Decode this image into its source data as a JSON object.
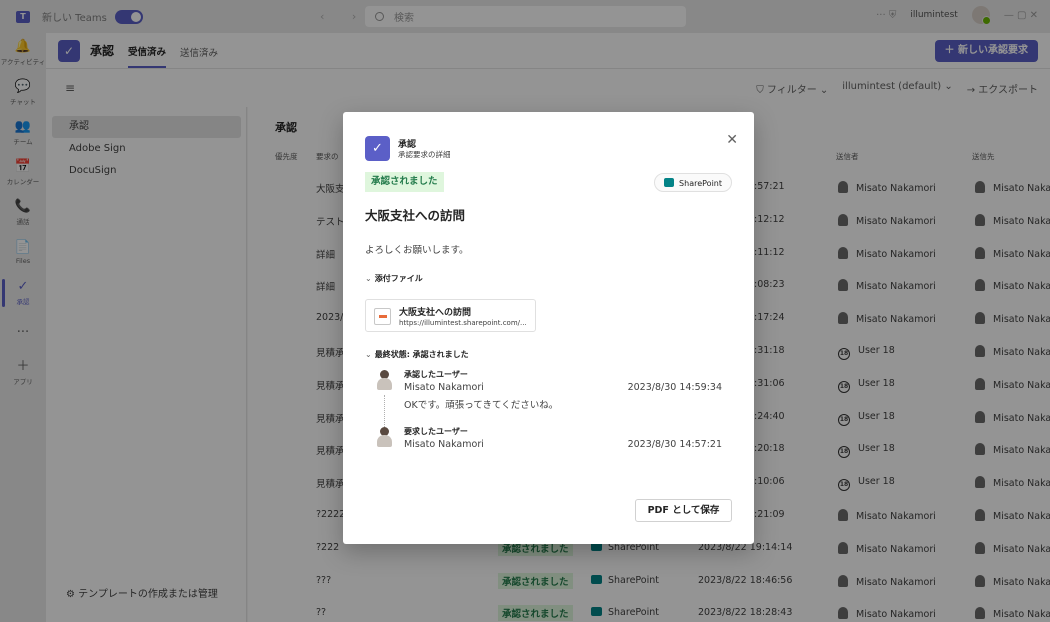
{
  "titlebar": {
    "new_teams_label": "新しい Teams",
    "search_placeholder": "検索",
    "user_name": "illumintest",
    "nav_arrows": "‹ ›",
    "right_icons": "··· ⛨",
    "window_controls": "— ▢ ✕"
  },
  "rail": {
    "items": [
      {
        "icon": "🔔",
        "label": "アクティビティ"
      },
      {
        "icon": "💬",
        "label": "チャット"
      },
      {
        "icon": "👥",
        "label": "チーム"
      },
      {
        "icon": "📅",
        "label": "カレンダー"
      },
      {
        "icon": "📞",
        "label": "通話"
      },
      {
        "icon": "📄",
        "label": "Files"
      },
      {
        "icon": "✓",
        "label": "承認"
      },
      {
        "icon": "···",
        "label": ""
      },
      {
        "icon": "＋",
        "label": "アプリ"
      }
    ]
  },
  "header": {
    "app_icon": "✓",
    "title": "承認",
    "tab_received": "受信済み",
    "tab_sent": "送信済み",
    "new_request_button": "＋ 新しい承認要求"
  },
  "toolbar": {
    "menu_icon": "≡",
    "filter_label": "⛉ フィルター ⌄",
    "environment_label": "illumintest (default) ⌄",
    "export_label": "→ エクスポート"
  },
  "sidelist": {
    "items": [
      "承認",
      "Adobe Sign",
      "DocuSign"
    ],
    "footer": "⚙ テンプレートの作成または管理"
  },
  "table": {
    "title": "承認",
    "headers": [
      "優先度",
      "要求の",
      "送信者",
      "送信先"
    ],
    "rows": [
      {
        "name": "大阪支",
        "time": ":57:21",
        "sender": "Misato Nakamori",
        "recipient": "Misato Nakan",
        "status": "",
        "source": "",
        "date": ""
      },
      {
        "name": "テスト",
        "time": ":12:12",
        "sender": "Misato Nakamori",
        "recipient": "Misato Nakan",
        "status": "",
        "source": "",
        "date": ""
      },
      {
        "name": "詳細",
        "time": ":11:12",
        "sender": "Misato Nakamori",
        "recipient": "Misato Nakan",
        "status": "",
        "source": "",
        "date": ""
      },
      {
        "name": "詳細",
        "time": ":08:23",
        "sender": "Misato Nakamori",
        "recipient": "Misato Nakan",
        "status": "",
        "source": "",
        "date": ""
      },
      {
        "name": "2023/",
        "time": ":17:24",
        "sender": "Misato Nakamori",
        "recipient": "Misato Nakan",
        "status": "",
        "source": "",
        "date": ""
      },
      {
        "name": "見積承",
        "time": ":31:18",
        "sender": "User 18",
        "recipient": "Misato Nakan",
        "status": "",
        "source": "",
        "date": ""
      },
      {
        "name": "見積承",
        "time": ":31:06",
        "sender": "User 18",
        "recipient": "Misato Nakan",
        "status": "",
        "source": "",
        "date": ""
      },
      {
        "name": "見積承",
        "time": ":24:40",
        "sender": "User 18",
        "recipient": "Misato Nakan",
        "status": "",
        "source": "",
        "date": ""
      },
      {
        "name": "見積承",
        "time": ":20:18",
        "sender": "User 18",
        "recipient": "Misato Nakan",
        "status": "",
        "source": "",
        "date": ""
      },
      {
        "name": "見積承",
        "time": ":10:06",
        "sender": "User 18",
        "recipient": "Misato Nakan",
        "status": "",
        "source": "",
        "date": ""
      },
      {
        "name": "?2222",
        "time": ":21:09",
        "sender": "Misato Nakamori",
        "recipient": "Misato Nakan",
        "status": "",
        "source": "",
        "date": ""
      },
      {
        "name": "?222",
        "time": "",
        "sender": "Misato Nakamori",
        "recipient": "Misato Nakan",
        "status": "承認されました",
        "source": "SharePoint",
        "date": "2023/8/22 19:14:14"
      },
      {
        "name": "???",
        "time": "",
        "sender": "Misato Nakamori",
        "recipient": "Misato Nakan",
        "status": "承認されました",
        "source": "SharePoint",
        "date": "2023/8/22 18:46:56"
      },
      {
        "name": "??",
        "time": "",
        "sender": "Misato Nakamori",
        "recipient": "Misato Nakan",
        "status": "承認されました",
        "source": "SharePoint",
        "date": "2023/8/22 18:28:43"
      }
    ]
  },
  "dialog": {
    "icon": "✓",
    "title": "承認",
    "subtitle": "承認要求の詳細",
    "close_icon": "✕",
    "status": "承認されました",
    "source": "SharePoint",
    "heading": "大阪支社への訪問",
    "message": "よろしくお願いします。",
    "attachments_header": "添付ファイル",
    "attachment_name": "大阪支社への訪問",
    "attachment_url": "https://illumintest.sharepoint.com/...",
    "final_status_header": "最終状態: 承認されました",
    "approver": {
      "role": "承認したユーザー",
      "name": "Misato Nakamori",
      "date": "2023/8/30 14:59:34",
      "note": "OKです。頑張ってきてくださいね。"
    },
    "requester": {
      "role": "要求したユーザー",
      "name": "Misato Nakamori",
      "date": "2023/8/30 14:57:21"
    },
    "pdf_button": "PDF として保存"
  },
  "colors": {
    "brand": "#5b5fc7",
    "status_green_bg": "#dff6dd",
    "status_green_text": "#237b4b",
    "sharepoint_teal": "#038387"
  }
}
